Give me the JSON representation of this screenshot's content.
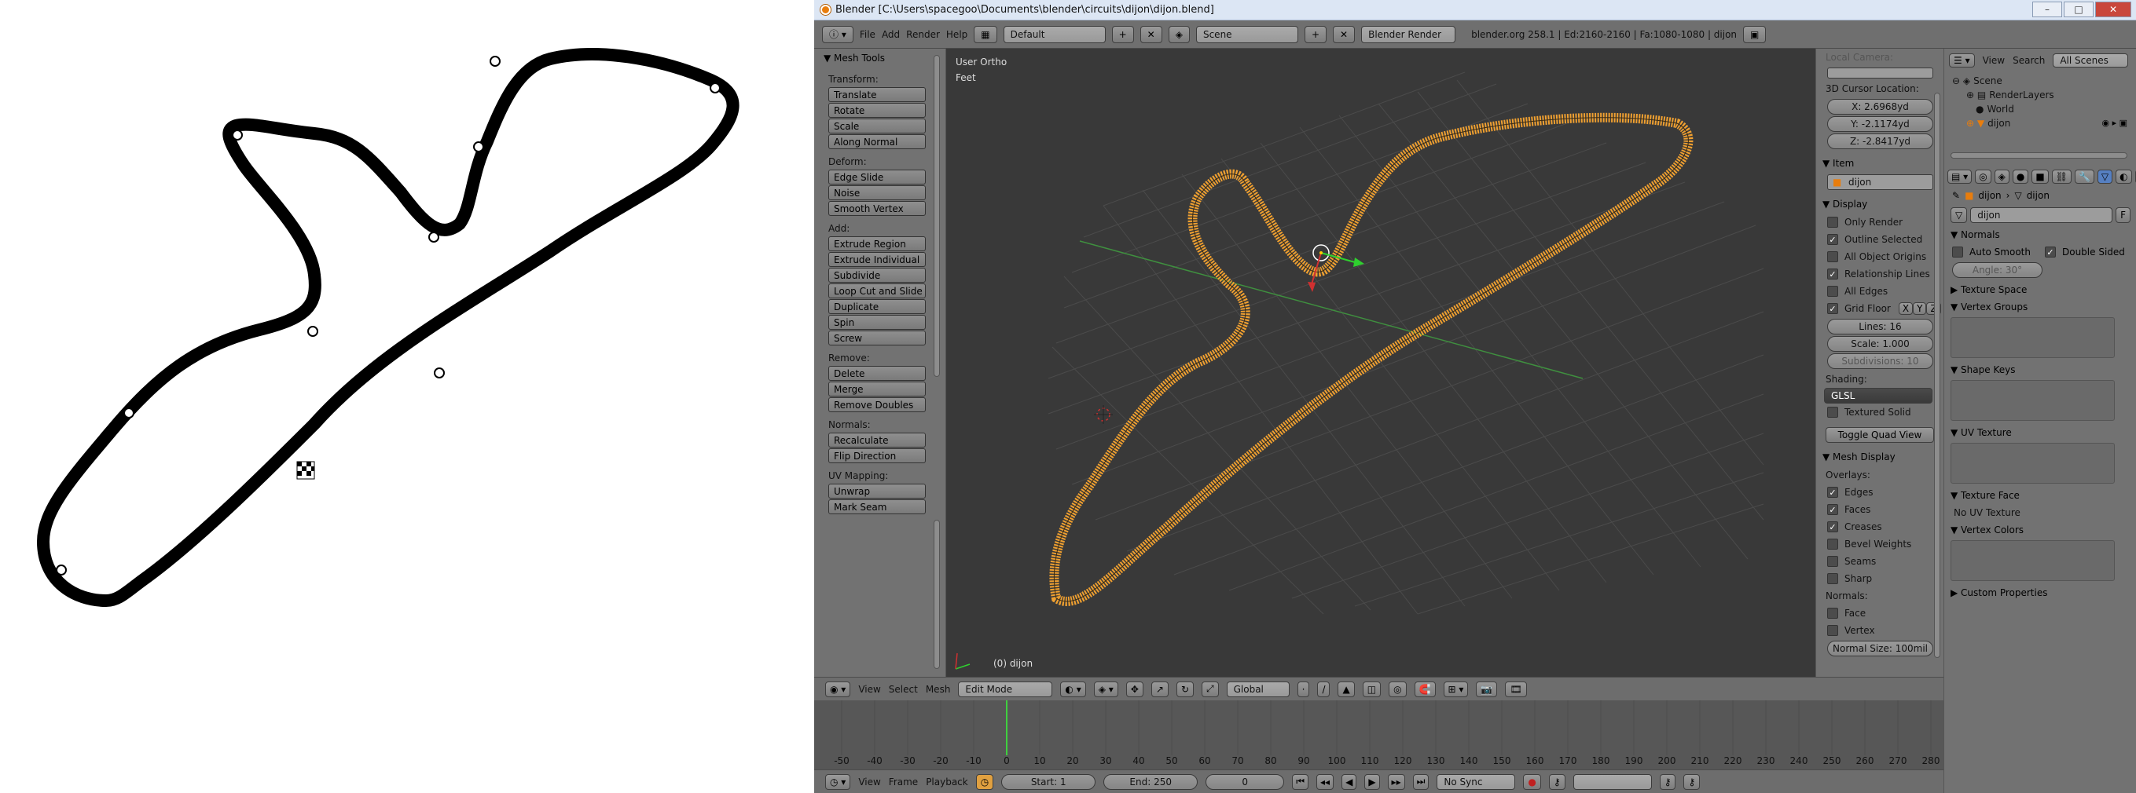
{
  "window": {
    "title": "Blender [C:\\Users\\spacegoo\\Documents\\blender\\circuits\\dijon\\dijon.blend]"
  },
  "menubar": {
    "menus": [
      "File",
      "Add",
      "Render",
      "Help"
    ],
    "layout": "Default",
    "scene": "Scene",
    "engine": "Blender Render",
    "stats": "blender.org 258.1 | Ed:2160-2160 | Fa:1080-1080 | dijon"
  },
  "toolshelf": {
    "title": "Mesh Tools",
    "sections": [
      {
        "label": "Transform:",
        "buttons": [
          "Translate",
          "Rotate",
          "Scale",
          "Along Normal"
        ]
      },
      {
        "label": "Deform:",
        "buttons": [
          "Edge Slide",
          "Noise",
          "Smooth Vertex"
        ]
      },
      {
        "label": "Add:",
        "buttons": [
          "Extrude Region",
          "Extrude Individual",
          "Subdivide",
          "Loop Cut and Slide",
          "Duplicate",
          "Spin",
          "Screw"
        ]
      },
      {
        "label": "Remove:",
        "buttons": [
          "Delete",
          "Merge",
          "Remove Doubles"
        ]
      },
      {
        "label": "Normals:",
        "buttons": [
          "Recalculate",
          "Flip Direction"
        ]
      },
      {
        "label": "UV Mapping:",
        "buttons": [
          "Unwrap",
          "Mark Seam"
        ]
      }
    ]
  },
  "viewport": {
    "view_name": "User Ortho",
    "units": "Feet",
    "object_label": "(0) dijon"
  },
  "npanel": {
    "local_camera": "Local Camera:",
    "cursor_label": "3D Cursor Location:",
    "cursor": [
      "X: 2.6968yd",
      "Y: -2.1174yd",
      "Z: -2.8417yd"
    ],
    "item_head": "Item",
    "item_name": "dijon",
    "display_head": "Display",
    "display_checks": [
      {
        "label": "Only Render",
        "checked": false
      },
      {
        "label": "Outline Selected",
        "checked": true
      },
      {
        "label": "All Object Origins",
        "checked": false
      },
      {
        "label": "Relationship Lines",
        "checked": true
      },
      {
        "label": "All Edges",
        "checked": false
      }
    ],
    "grid_floor": "Grid Floor",
    "axes": [
      "X",
      "Y",
      "Z"
    ],
    "lines": "Lines: 16",
    "scale": "Scale: 1.000",
    "subdivisions": "Subdivisions: 10",
    "shading_label": "Shading:",
    "shading_value": "GLSL",
    "textured_solid": "Textured Solid",
    "toggle_quad": "Toggle Quad View",
    "mesh_display_head": "Mesh Display",
    "overlays_label": "Overlays:",
    "overlays": [
      {
        "label": "Edges",
        "checked": true
      },
      {
        "label": "Faces",
        "checked": true
      },
      {
        "label": "Creases",
        "checked": true
      },
      {
        "label": "Bevel Weights",
        "checked": false
      },
      {
        "label": "Seams",
        "checked": false
      },
      {
        "label": "Sharp",
        "checked": false
      }
    ],
    "normals_label": "Normals:",
    "normals": [
      {
        "label": "Face",
        "checked": false
      },
      {
        "label": "Vertex",
        "checked": false
      }
    ],
    "normal_size": "Normal Size: 100mil"
  },
  "outliner": {
    "menus": [
      "View",
      "Search"
    ],
    "filter": "All Scenes",
    "items": [
      "Scene",
      "RenderLayers",
      "World",
      "dijon"
    ]
  },
  "properties": {
    "crumb_a": "dijon",
    "crumb_b": "dijon",
    "mesh_name": "dijon",
    "fake_user": "F",
    "normals_head": "Normals",
    "auto_smooth": "Auto Smooth",
    "double_sided": "Double Sided",
    "angle": "Angle: 30°",
    "panels": [
      "Texture Space",
      "Vertex Groups",
      "Shape Keys",
      "UV Texture",
      "Texture Face",
      "Vertex Colors",
      "Custom Properties"
    ],
    "no_uv": "No UV Texture"
  },
  "view3d_header": {
    "menus": [
      "View",
      "Select",
      "Mesh"
    ],
    "mode": "Edit Mode",
    "orientation": "Global"
  },
  "timeline": {
    "ticks": [
      "-50",
      "-40",
      "-30",
      "-20",
      "-10",
      "0",
      "10",
      "20",
      "30",
      "40",
      "50",
      "60",
      "70",
      "80",
      "90",
      "100",
      "110",
      "120",
      "130",
      "140",
      "150",
      "160",
      "170",
      "180",
      "190",
      "200",
      "210",
      "220",
      "230",
      "240",
      "250",
      "260",
      "270",
      "280"
    ],
    "menus": [
      "View",
      "Frame",
      "Playback"
    ],
    "start": "Start: 1",
    "end": "End: 250",
    "current": "0",
    "sync": "No Sync"
  },
  "colors": {
    "track": "#000000",
    "mesh": "#f0a030",
    "bg": "#393939",
    "ui": "#727272"
  }
}
